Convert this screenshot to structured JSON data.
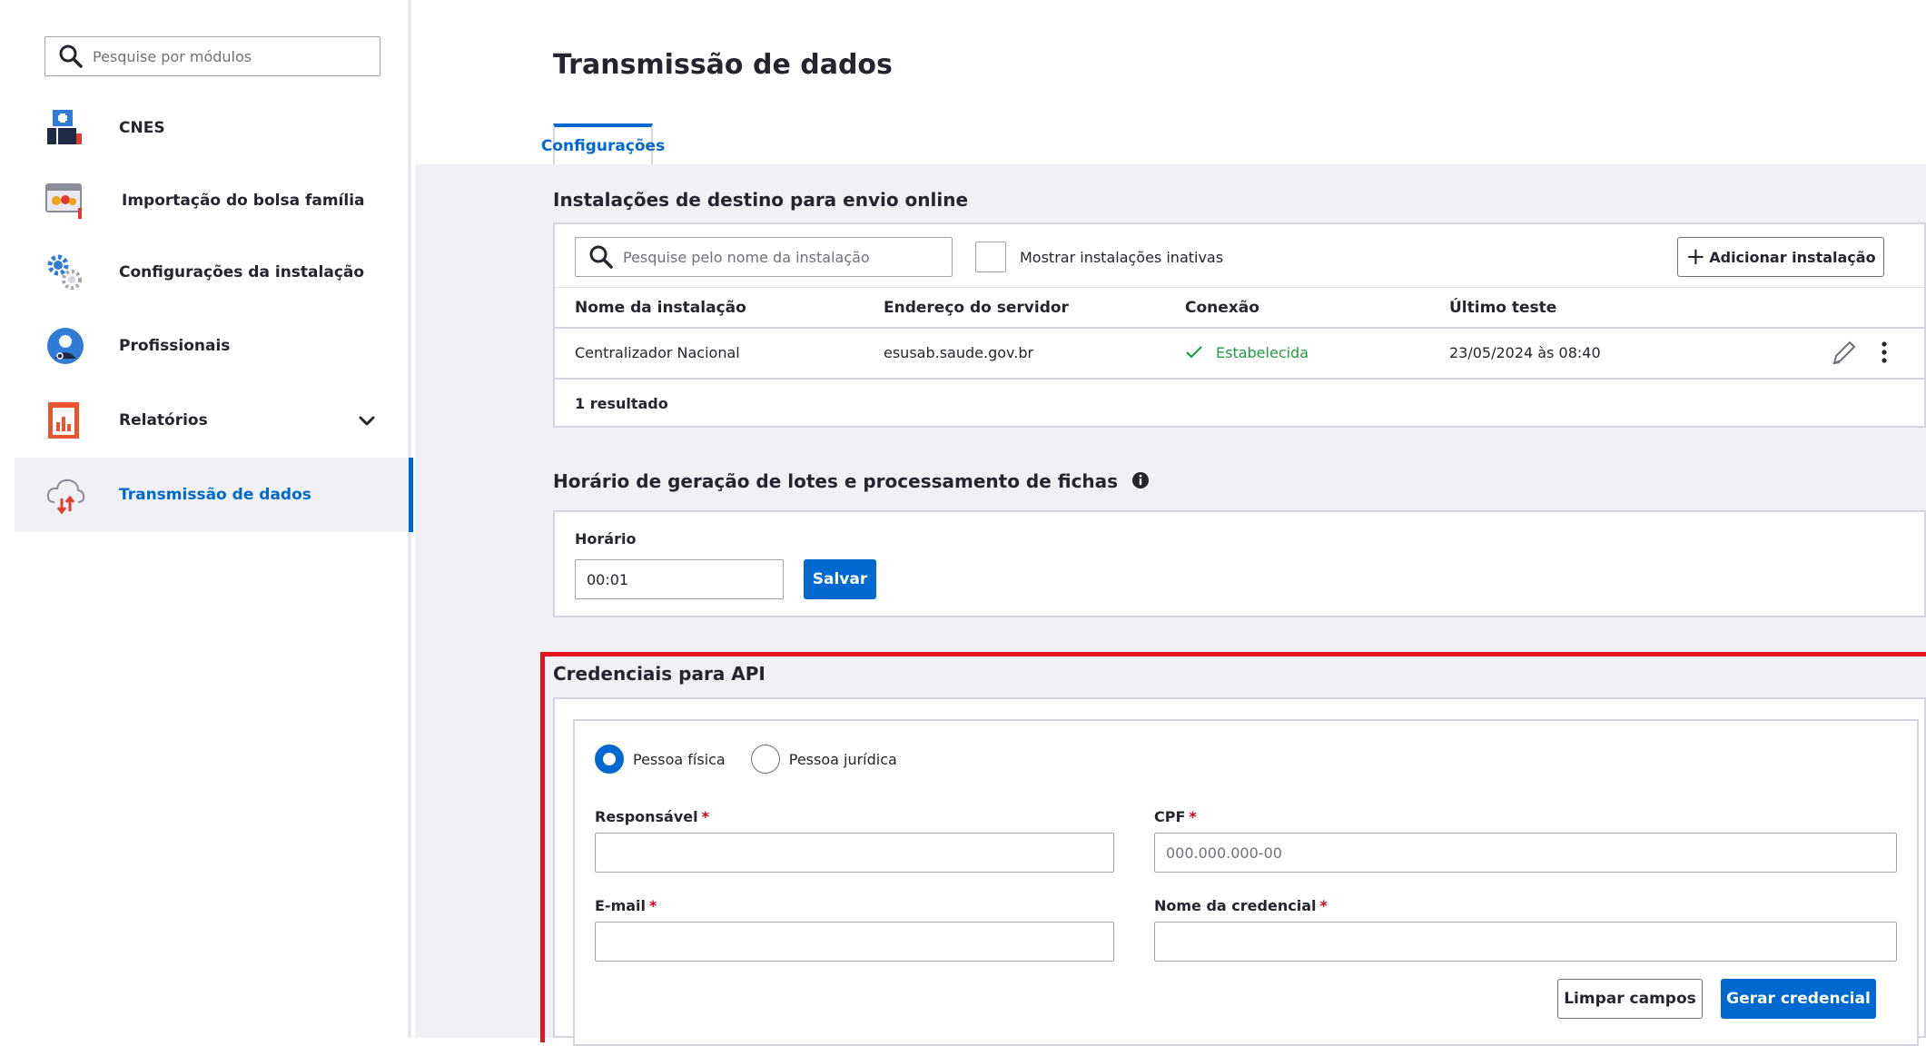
{
  "sidebar": {
    "search_placeholder": "Pesquise por módulos",
    "items": [
      {
        "label": "CNES",
        "icon": "cnes-icon"
      },
      {
        "label": "Importação do bolsa família",
        "icon": "bolsa-familia-icon"
      },
      {
        "label": "Configurações da instalação",
        "icon": "gears-icon"
      },
      {
        "label": "Profissionais",
        "icon": "professional-icon"
      },
      {
        "label": "Relatórios",
        "icon": "report-icon"
      },
      {
        "label": "Transmissão de dados",
        "icon": "cloud-transfer-icon"
      }
    ]
  },
  "header": {
    "title": "Transmissão de dados",
    "tabs": [
      {
        "label": "Configurações"
      }
    ]
  },
  "destinations": {
    "title": "Instalações de destino para envio online",
    "search_placeholder": "Pesquise pelo nome da instalação",
    "show_inactive_label": "Mostrar instalações inativas",
    "add_button": "Adicionar instalação",
    "columns": [
      "Nome da instalação",
      "Endereço do servidor",
      "Conexão",
      "Último teste"
    ],
    "rows": [
      {
        "name": "Centralizador Nacional",
        "server": "esusab.saude.gov.br",
        "connection": "Estabelecida",
        "last_test": "23/05/2024 às 08:40"
      }
    ],
    "result_count": "1 resultado"
  },
  "schedule": {
    "title": "Horário de geração de lotes e processamento de fichas",
    "field_label": "Horário",
    "value": "00:01",
    "save_button": "Salvar"
  },
  "credentials": {
    "title": "Credenciais para API",
    "person_types": [
      "Pessoa física",
      "Pessoa jurídica"
    ],
    "selected_type": "Pessoa física",
    "responsavel_label": "Responsável",
    "cpf_label": "CPF",
    "cpf_placeholder": "000.000.000-00",
    "email_label": "E-mail",
    "credential_name_label": "Nome da credencial",
    "required_marker": "*",
    "clear_button": "Limpar campos",
    "generate_button": "Gerar credencial"
  },
  "colors": {
    "primary": "#0069d0",
    "success": "#1e9d40",
    "highlight_border": "#e1151b",
    "required": "#d0021b"
  }
}
